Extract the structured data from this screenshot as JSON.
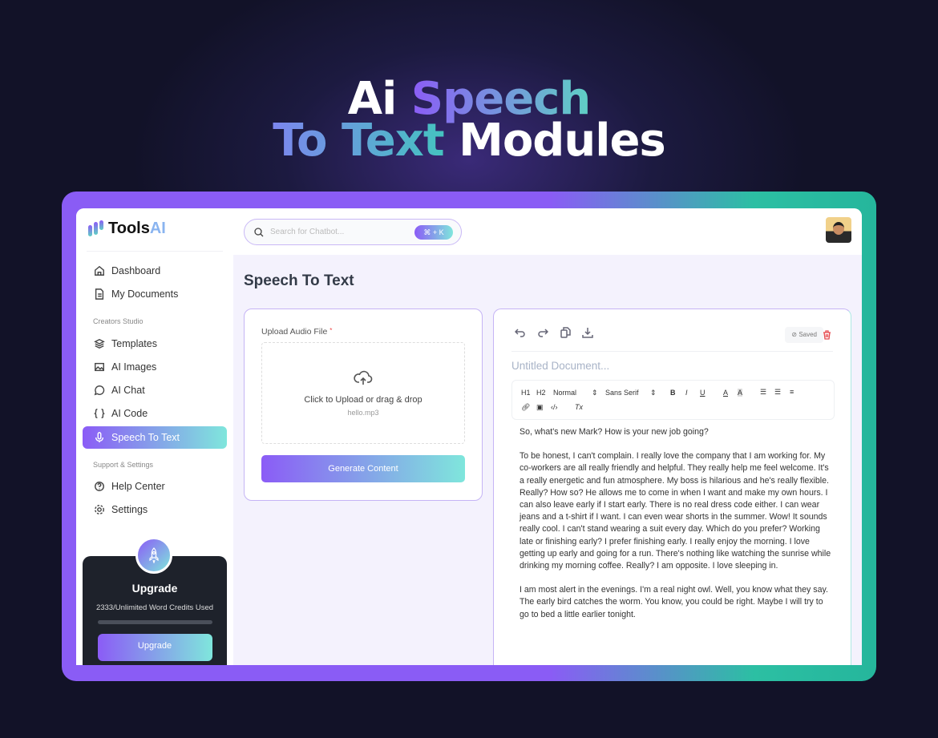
{
  "hero": {
    "line1_white": "Ai",
    "line1_grad": "Speech",
    "line2_grad": "To Text",
    "line2_white": "Modules"
  },
  "logo": {
    "name_a": "Tools",
    "name_b": "AI"
  },
  "search": {
    "placeholder": "Search for Chatbot...",
    "shortcut": "⌘ + K"
  },
  "sidebar": {
    "items": [
      {
        "label": "Dashboard",
        "icon": "home-icon"
      },
      {
        "label": "My Documents",
        "icon": "document-icon"
      }
    ],
    "section1": "Creators Studio",
    "studio": [
      {
        "label": "Templates",
        "icon": "layers-icon"
      },
      {
        "label": "AI Images",
        "icon": "image-icon"
      },
      {
        "label": "AI Chat",
        "icon": "chat-icon"
      },
      {
        "label": "AI Code",
        "icon": "code-icon"
      },
      {
        "label": "Speech To Text",
        "icon": "microphone-icon",
        "active": true
      }
    ],
    "section2": "Support & Settings",
    "support": [
      {
        "label": "Help Center",
        "icon": "help-icon"
      },
      {
        "label": "Settings",
        "icon": "gear-icon"
      }
    ],
    "upgrade": {
      "title": "Upgrade",
      "credits": "2333/Unlimited Word Credits Used",
      "usage_fraction": 0,
      "button": "Upgrade"
    }
  },
  "page": {
    "title": "Speech To Text"
  },
  "upload": {
    "label": "Upload Audio File",
    "required": "*",
    "drop_text": "Click to Upload or drag & drop",
    "file_name": "hello.mp3",
    "generate": "Generate Content"
  },
  "editor": {
    "saved": "Saved",
    "title_placeholder": "Untitled Document...",
    "toolbar": {
      "h1": "H1",
      "h2": "H2",
      "style": "Normal",
      "font": "Sans Serif",
      "bold": "B",
      "italic": "I",
      "underline": "U",
      "color": "A",
      "bg": "A",
      "clear": "Tx",
      "code": "‹/›"
    },
    "paragraphs": [
      "So, what's new Mark? How is your new job going?",
      "To be honest, I can't complain. I really love the company that I am working for. My co-workers are all really friendly and helpful. They really help me feel welcome. It's a really energetic and fun atmosphere. My boss is hilarious and he's really flexible. Really? How so? He allows me to come in when I want and make my own hours. I can also leave early if I start early. There is no real dress code either. I can wear jeans and a t-shirt if I want. I can even wear shorts in the summer. Wow! It sounds really cool. I can't stand wearing a suit every day. Which do you prefer? Working late or finishing early? I prefer finishing early. I really enjoy the morning. I love getting up early and going for a run. There's nothing like watching the sunrise while drinking my morning coffee. Really? I am opposite. I love sleeping in.",
      "I am most alert in the evenings. I'm a real night owl. Well, you know what they say. The early bird catches the worm. You know, you could be right. Maybe I will try to go to bed a little earlier tonight."
    ]
  }
}
